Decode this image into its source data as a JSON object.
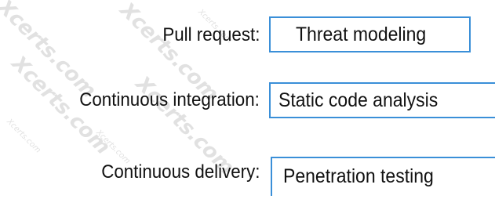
{
  "rows": [
    {
      "label": "Pull request:",
      "answer": "Threat modeling"
    },
    {
      "label": "Continuous integration:",
      "answer": "Static code analysis"
    },
    {
      "label": "Continuous delivery:",
      "answer": "Penetration testing"
    }
  ],
  "watermark": {
    "text_big": "Xcerts.com",
    "text_small": "Xcerts.com"
  },
  "colors": {
    "box_border": "#3a8fd8",
    "text": "#111111",
    "background": "#ffffff"
  }
}
